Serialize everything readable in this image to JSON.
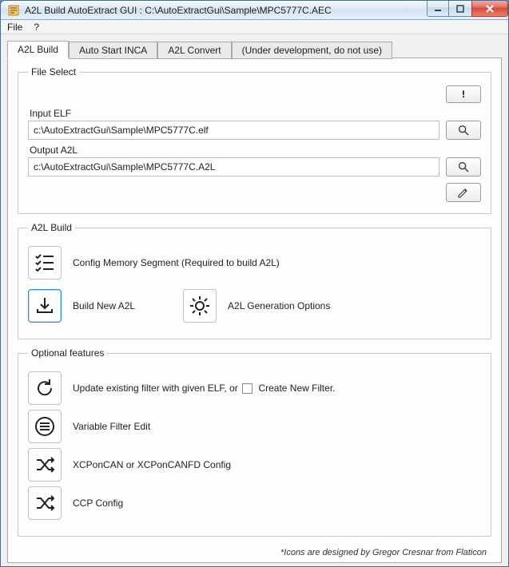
{
  "window": {
    "title": "A2L Build AutoExtract GUI : C:\\AutoExtractGui\\Sample\\MPC5777C.AEC"
  },
  "menu": {
    "file": "File",
    "help": "?"
  },
  "tabs": {
    "build": "A2L Build",
    "inca": "Auto Start INCA",
    "convert": "A2L Convert",
    "dev": "(Under development, do not use)"
  },
  "fileSelect": {
    "legend": "File Select",
    "warnBtn": "!",
    "inputElfLabel": "Input ELF",
    "inputElfValue": "c:\\AutoExtractGui\\Sample\\MPC5777C.elf",
    "outputA2lLabel": "Output A2L",
    "outputA2lValue": "c:\\AutoExtractGui\\Sample\\MPC5777C.A2L"
  },
  "a2lBuild": {
    "legend": "A2L Build",
    "configMem": "Config Memory Segment (Required to build A2L)",
    "buildNew": "Build New A2L",
    "genOptions": "A2L Generation Options"
  },
  "optional": {
    "legend": "Optional features",
    "updateFilterPrefix": "Update existing filter with given ELF, or",
    "createNewFilter": "Create New Filter.",
    "variableFilterEdit": "Variable Filter Edit",
    "xcpConfig": "XCPonCAN or XCPonCANFD Config",
    "ccpConfig": "CCP Config"
  },
  "footer": "*Icons are designed by Gregor Cresnar from Flaticon"
}
